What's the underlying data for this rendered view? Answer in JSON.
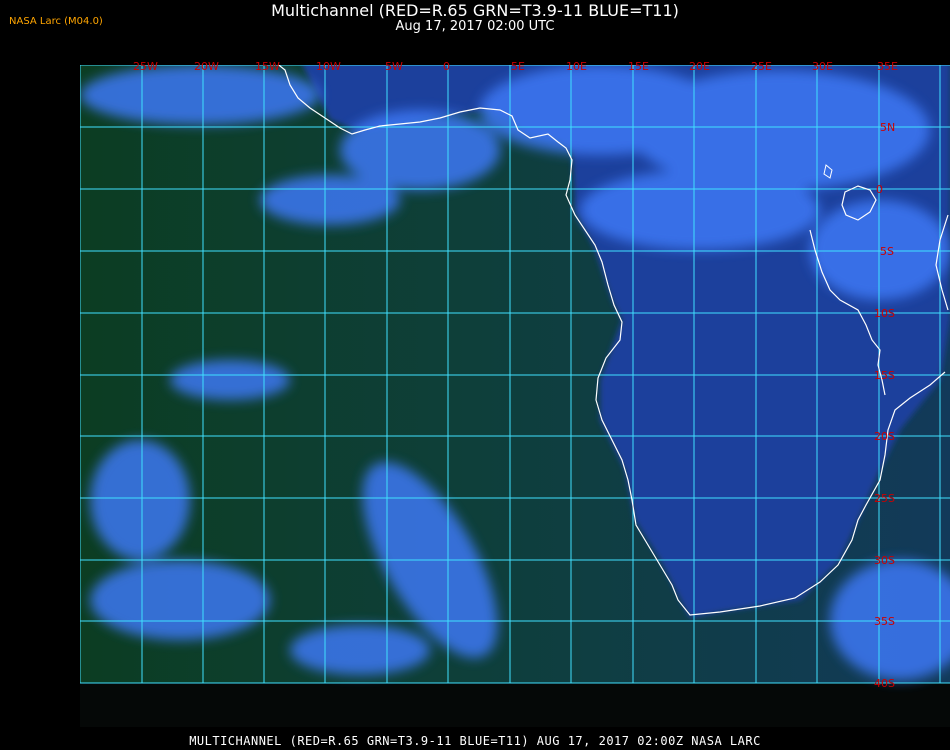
{
  "header": {
    "title": "Multichannel (RED=R.65 GRN=T3.9-11 BLUE=T11)",
    "datetime": "Aug 17, 2017 02:00 UTC",
    "producer": "NASA Larc (M04.0)"
  },
  "footer": {
    "caption": "MULTICHANNEL (RED=R.65 GRN=T3.9-11 BLUE=T11) AUG 17, 2017 02:00Z  NASA LARC"
  },
  "map": {
    "region": "Southern Africa / South Atlantic",
    "projection": "lat-lon grid",
    "lon_labels": [
      "25W",
      "20W",
      "15W",
      "10W",
      "5W",
      "0",
      "5E",
      "10E",
      "15E",
      "20E",
      "25E",
      "30E",
      "35E"
    ],
    "lat_labels": [
      "5N",
      "0",
      "5S",
      "10S",
      "15S",
      "20S",
      "25S",
      "30S",
      "35S",
      "40S"
    ],
    "colors": {
      "grid": "#40e0ff",
      "coastline": "#ffffff",
      "grid_labels": "#cc0000",
      "ocean_clear": "#0a3a22",
      "land": "#1f3f9a",
      "cloud": "#3f7fff"
    }
  }
}
